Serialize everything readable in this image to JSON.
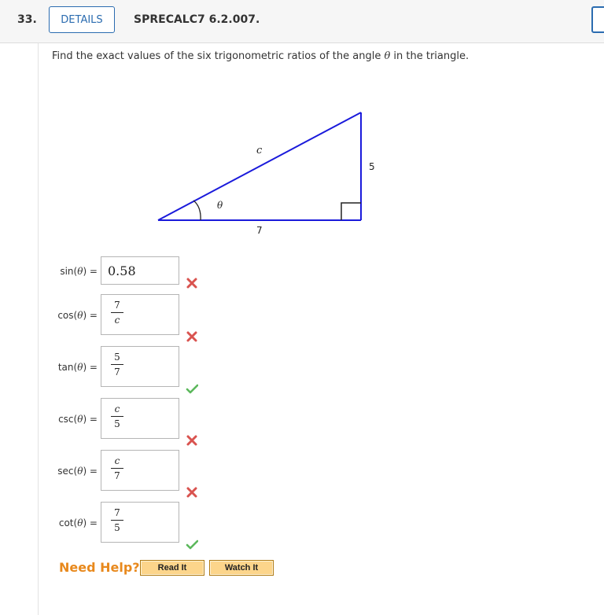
{
  "header": {
    "question_number": "33.",
    "details_label": "DETAILS",
    "question_code": "SPRECALC7 6.2.007."
  },
  "prompt": {
    "before": "Find the exact values of the six trigonometric ratios of the angle ",
    "theta": "θ",
    "after": " in the triangle."
  },
  "triangle": {
    "hyp_label": "c",
    "vert_label": "5",
    "base_label": "7",
    "angle_label": "θ",
    "line_color": "#1a1adb"
  },
  "answers": [
    {
      "fn": "sin",
      "theta": "θ",
      "paren_open": "(",
      "paren_close": ") =",
      "kind": "plain",
      "value": "0.58",
      "status": "incorrect"
    },
    {
      "fn": "cos",
      "theta": "θ",
      "paren_open": "(",
      "paren_close": ") =",
      "kind": "frac",
      "num": "7",
      "den": "c",
      "den_italic": true,
      "num_italic": false,
      "status": "incorrect"
    },
    {
      "fn": "tan",
      "theta": "θ",
      "paren_open": "(",
      "paren_close": ") =",
      "kind": "frac",
      "num": "5",
      "den": "7",
      "den_italic": false,
      "num_italic": false,
      "status": "correct"
    },
    {
      "fn": "csc",
      "theta": "θ",
      "paren_open": "(",
      "paren_close": ") =",
      "kind": "frac",
      "num": "c",
      "den": "5",
      "den_italic": false,
      "num_italic": true,
      "status": "incorrect"
    },
    {
      "fn": "sec",
      "theta": "θ",
      "paren_open": "(",
      "paren_close": ") =",
      "kind": "frac",
      "num": "c",
      "den": "7",
      "den_italic": false,
      "num_italic": true,
      "status": "incorrect"
    },
    {
      "fn": "cot",
      "theta": "θ",
      "paren_open": "(",
      "paren_close": ") =",
      "kind": "frac",
      "num": "7",
      "den": "5",
      "den_italic": false,
      "num_italic": false,
      "status": "correct"
    }
  ],
  "status_icons": {
    "correct": "check-icon",
    "incorrect": "x-icon"
  },
  "colors": {
    "correct": "#5cb85c",
    "incorrect": "#d9534f",
    "help": "#e8891d",
    "button_bg": "#fcd58b"
  },
  "help": {
    "label": "Need Help?",
    "read_it": "Read It",
    "watch_it": "Watch It"
  }
}
